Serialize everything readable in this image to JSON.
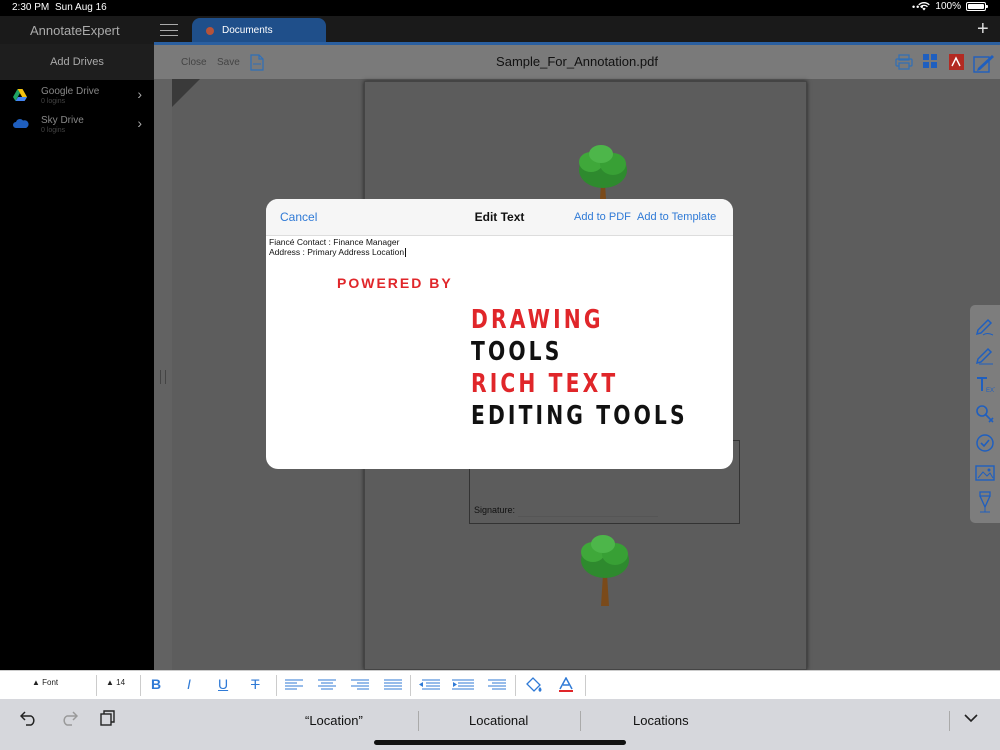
{
  "status_bar": {
    "time": "2:30 PM",
    "date": "Sun Aug 16",
    "battery": "100%",
    "battery_level": 1.0
  },
  "app": {
    "title": "AnnotateExpert",
    "tab_label": "Documents"
  },
  "sidebar": {
    "add_drives": "Add Drives",
    "drives": [
      {
        "name": "Google Drive",
        "sub": "0 logins",
        "icon": "google-drive-icon"
      },
      {
        "name": "Sky Drive",
        "sub": "0 logins",
        "icon": "sky-drive-icon"
      }
    ]
  },
  "doc_toolbar": {
    "close": "Close",
    "save": "Save",
    "title": "Sample_For_Annotation.pdf"
  },
  "page": {
    "signature_label": "Signature:"
  },
  "modal": {
    "cancel": "Cancel",
    "title": "Edit Text",
    "add_to_pdf": "Add to PDF",
    "add_to_template": "Add to Template",
    "line1": "Fiancé Contact :  Finance Manager",
    "line2": "Address :  Primary Address Location",
    "powered_by": "POWERED BY",
    "banner": [
      "DRAWING",
      "TOOLS",
      "RICH TEXT",
      "EDITING TOOLS"
    ]
  },
  "format_bar": {
    "font_label": "Font",
    "size_label": "14"
  },
  "keyboard": {
    "suggestions": [
      "“Location”",
      "Locational",
      "Locations"
    ]
  },
  "colors": {
    "accent": "#2f7ad6",
    "brand_red": "#e0262a",
    "tab_blue": "#1f4f8a"
  }
}
